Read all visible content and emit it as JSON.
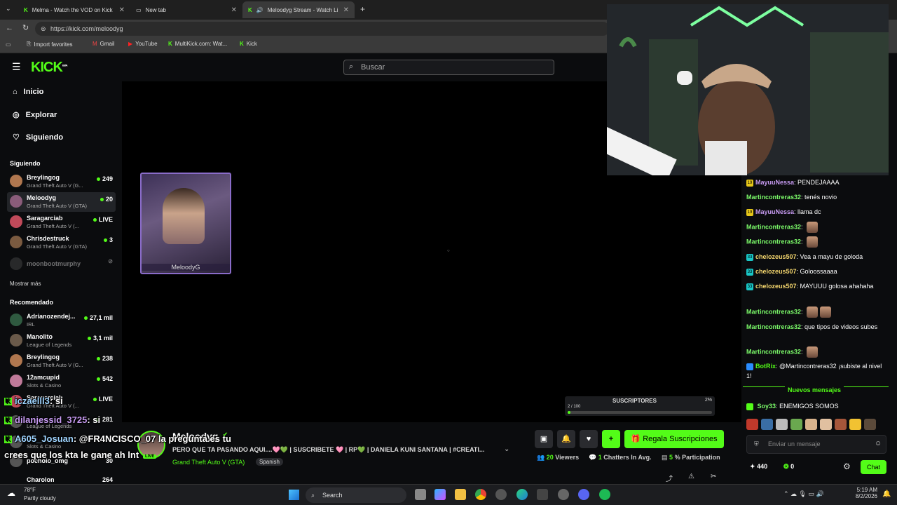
{
  "browser": {
    "tabs": [
      {
        "title": "Melma - Watch the VOD on Kick"
      },
      {
        "title": "New tab"
      },
      {
        "title": "Meloodyg Stream - Watch Li..."
      }
    ],
    "url": "https://kick.com/meloodyg",
    "bookmarks": [
      "Import favorites",
      "Gmail",
      "YouTube",
      "MultiKick.com: Wat...",
      "Kick"
    ]
  },
  "nav": {
    "logo": "KICK",
    "logo_badge": "BETA",
    "search_placeholder": "Buscar",
    "items": [
      "Inicio",
      "Explorar",
      "Siguiendo"
    ]
  },
  "sidebar": {
    "following_title": "Siguiendo",
    "following": [
      {
        "name": "Breylingog",
        "game": "Grand Theft Auto V (G...",
        "viewers": "249",
        "avatar_color": "#b0774f"
      },
      {
        "name": "Meloodyg",
        "game": "Grand Theft Auto V (GTA)",
        "viewers": "20",
        "avatar_color": "#8a5c7a"
      },
      {
        "name": "Saragarciab",
        "game": "Grand Theft Auto V (...",
        "viewers": "LIVE",
        "avatar_color": "#c04a5a"
      },
      {
        "name": "Chrisdestruck",
        "game": "Grand Theft Auto V (GTA)",
        "viewers": "3",
        "avatar_color": "#7a5a40"
      },
      {
        "name": "moonbootmurphy",
        "game": "",
        "viewers": "",
        "avatar_color": "#555555"
      }
    ],
    "show_more": "Mostrar más",
    "recommended_title": "Recomendado",
    "recommended": [
      {
        "name": "Adrianozendej...",
        "game": "IRL",
        "viewers": "27,1 mil",
        "avatar_color": "#2f5a40"
      },
      {
        "name": "Manolito",
        "game": "League of Legends",
        "viewers": "3,1 mil",
        "avatar_color": "#6a5a4a"
      },
      {
        "name": "Breylingog",
        "game": "Grand Theft Auto V (G...",
        "viewers": "238",
        "avatar_color": "#b0774f"
      },
      {
        "name": "12amcupid",
        "game": "Slots & Casino",
        "viewers": "542",
        "avatar_color": "#c07a9a"
      },
      {
        "name": "Saragarciab",
        "game": "Grand Theft Auto V (...",
        "viewers": "LIVE",
        "avatar_color": "#c04a5a"
      },
      {
        "name": "",
        "game": "League of Legends",
        "viewers": "281",
        "avatar_color": "#555555"
      },
      {
        "name": "",
        "game": "Slots & Casino",
        "viewers": "",
        "avatar_color": "#555555"
      },
      {
        "name": "pochoio_omg",
        "game": "",
        "viewers": "30",
        "avatar_color": "#555555"
      },
      {
        "name": "Charolon",
        "game": "",
        "viewers": "264",
        "avatar_color": "#555555"
      }
    ]
  },
  "player": {
    "offline_name": "MeloodyG",
    "sub_goal_label": "SUSCRIPTORES",
    "sub_goal_count": "2 / 100",
    "sub_goal_pct": "2%",
    "sub_goal_fraction": 0.02
  },
  "stream": {
    "streamer": "Meloodyg",
    "title": "PERO QUE TA PASANDO AQUI....🩷💚 | SUSCRIBETE 🩷 | RP💚 | DANIELA KUNI SANTANA | #CREATI...",
    "category": "Grand Theft Auto V (GTA)",
    "language": "Spanish",
    "live_badge": "LIVE",
    "gift_label": "Regala Suscripciones",
    "viewers": "20",
    "viewers_label": "Viewers",
    "chatters": "1",
    "chatters_label": "Chatters In Avg.",
    "participation": "5",
    "participation_label": "% Participation"
  },
  "overlay_chat": [
    {
      "user": "iczaelll3",
      "text": "si"
    },
    {
      "user": "dilanjessid_3725",
      "text": "si"
    },
    {
      "user": "A605_Josuan",
      "text": "@FR4NCISCO_07 la pregunta es tu"
    },
    {
      "user": "",
      "text": "crees que los kta le gane ah lnt"
    }
  ],
  "chat": {
    "messages": [
      {
        "badge": "19",
        "badge_color": "#e6c619",
        "user": "MayuuNessa",
        "user_color": "#c79bf2",
        "text": "PENDEJAAAA",
        "emotes": 0
      },
      {
        "badge": "",
        "badge_color": "",
        "user": "Martincontreras32",
        "user_color": "#7cfc6a",
        "text": "tenés novio",
        "emotes": 0
      },
      {
        "badge": "19",
        "badge_color": "#e6c619",
        "user": "MayuuNessa",
        "user_color": "#c79bf2",
        "text": "llama dc",
        "emotes": 0
      },
      {
        "badge": "",
        "badge_color": "",
        "user": "Martincontreras32",
        "user_color": "#7cfc6a",
        "text": "",
        "emotes": 1
      },
      {
        "badge": "",
        "badge_color": "",
        "user": "Martincontreras32",
        "user_color": "#7cfc6a",
        "text": "",
        "emotes": 1
      },
      {
        "badge": "33",
        "badge_color": "#19c6c6",
        "user": "chelozeus507",
        "user_color": "#f5d76e",
        "text": "Vea a mayu de goloda",
        "emotes": 0
      },
      {
        "badge": "33",
        "badge_color": "#19c6c6",
        "user": "chelozeus507",
        "user_color": "#f5d76e",
        "text": "Goloossaaaa",
        "emotes": 0
      },
      {
        "badge": "33",
        "badge_color": "#19c6c6",
        "user": "chelozeus507",
        "user_color": "#f5d76e",
        "text": "MAYUUU golosa ahahaha",
        "emotes": 0
      },
      {
        "badge": "",
        "badge_color": "",
        "user": "Martincontreras32",
        "user_color": "#7cfc6a",
        "text": "",
        "emotes": 2
      },
      {
        "badge": "",
        "badge_color": "",
        "user": "Martincontreras32",
        "user_color": "#7cfc6a",
        "text": "que tipos de videos subes",
        "emotes": 0
      },
      {
        "badge": "",
        "badge_color": "",
        "user": "Martincontreras32",
        "user_color": "#7cfc6a",
        "text": "",
        "emotes": 1
      },
      {
        "badge": "",
        "badge_color": "#2a8cff",
        "user": "BotRix",
        "user_color": "#53fc18",
        "text": "@Martincontreras32 ¡subiste al nivel 1!",
        "emotes": 0
      }
    ],
    "new_messages_label": "Nuevos mensajes",
    "last_message": {
      "user": "Soy33",
      "text": "ENEMIGOS SOMOS"
    },
    "input_placeholder": "Enviar un mensaje",
    "points": "440",
    "kicks": "0",
    "chat_button": "Chat"
  },
  "taskbar": {
    "weather_temp": "78°F",
    "weather_desc": "Partly cloudy",
    "search_label": "Search",
    "time": "5:19 AM",
    "date": "8/2/2026"
  },
  "colors": {
    "accent": "#53fc18",
    "background": "#0b0c0e"
  }
}
